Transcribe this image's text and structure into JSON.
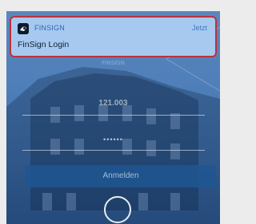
{
  "notification": {
    "app_name": "FINSIGN",
    "time": "Jetzt",
    "message": "FinSign Login",
    "app_icon": "finsign-logo-icon"
  },
  "login": {
    "top_hint": "FINSIGN",
    "user_value": "121.003",
    "password_mask": "••••••",
    "submit_label": "Anmelden"
  },
  "colors": {
    "highlight_border": "#c0303b",
    "accent": "#2c68b8"
  }
}
